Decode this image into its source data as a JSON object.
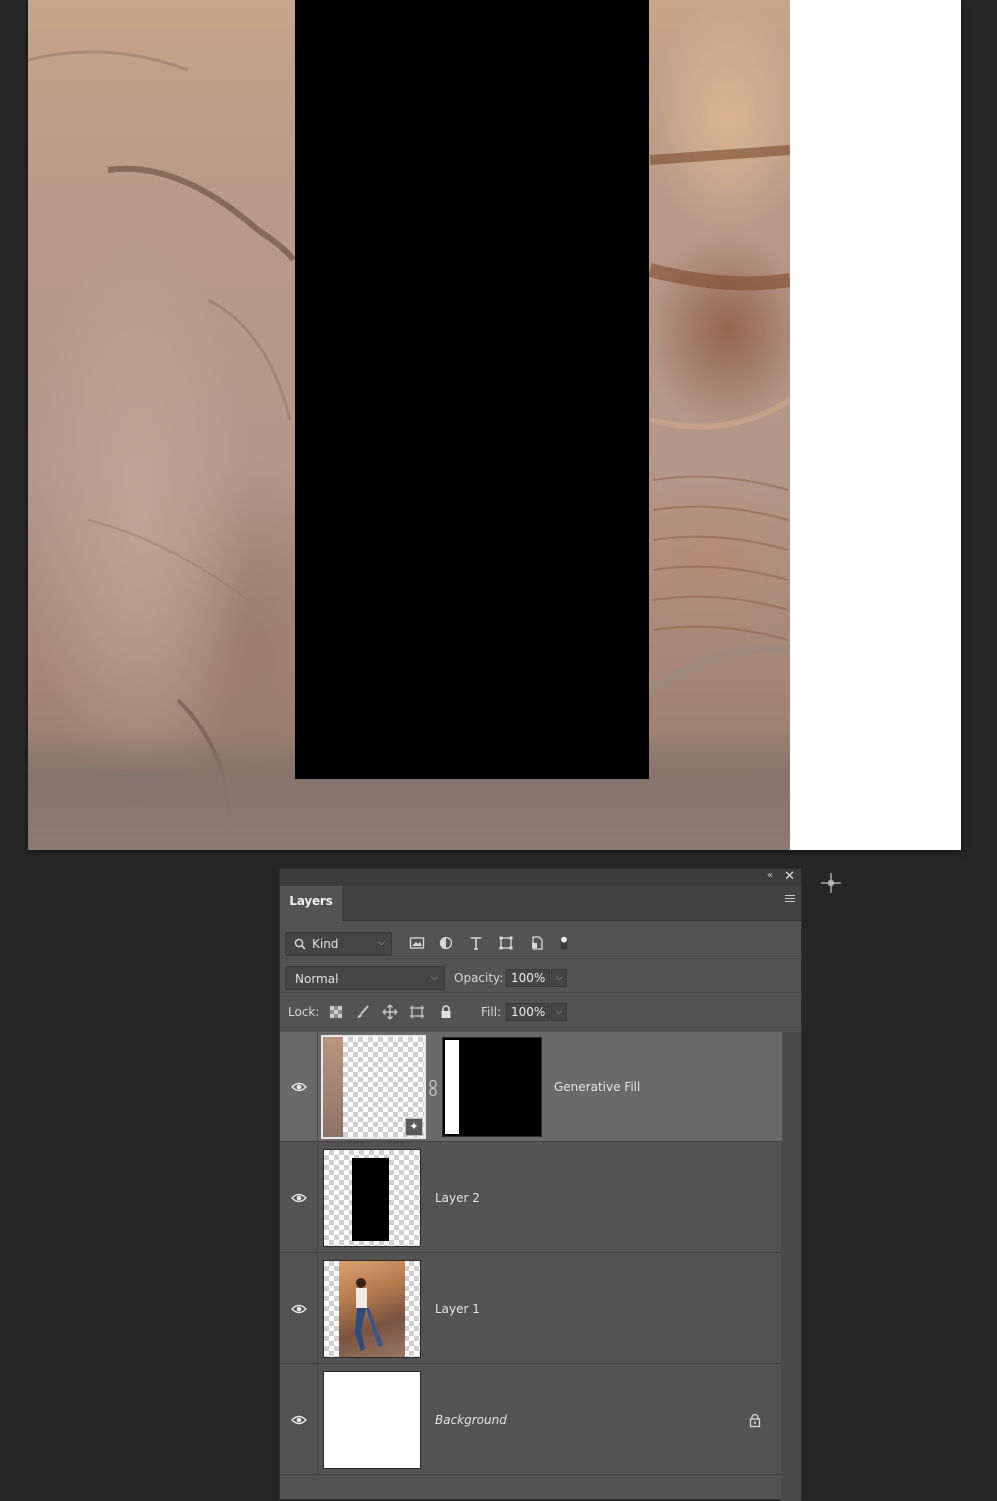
{
  "panel": {
    "tab_label": "Layers",
    "collapse_icon": "double-chevron-left-icon",
    "close_icon": "close-icon",
    "menu_icon": "panel-menu-icon"
  },
  "filter": {
    "kind_label": "Kind",
    "icons": [
      "image-filter-icon",
      "adjustment-filter-icon",
      "type-filter-icon",
      "shape-filter-icon",
      "smart-object-filter-icon",
      "filter-toggle-icon"
    ]
  },
  "blend": {
    "mode": "Normal",
    "opacity_label": "Opacity:",
    "opacity_value": "100%"
  },
  "lock": {
    "label": "Lock:",
    "icons": [
      "lock-transparent-pixels-icon",
      "lock-image-pixels-icon",
      "lock-position-icon",
      "lock-artboard-icon",
      "lock-all-icon"
    ],
    "fill_label": "Fill:",
    "fill_value": "100%"
  },
  "layers": [
    {
      "name": "Generative Fill",
      "visible": true,
      "selected": true,
      "has_mask": true
    },
    {
      "name": "Layer 2",
      "visible": true,
      "selected": false
    },
    {
      "name": "Layer 1",
      "visible": true,
      "selected": false
    },
    {
      "name": "Background",
      "visible": true,
      "selected": false,
      "locked": true
    }
  ],
  "colors": {
    "app_background": "#262626",
    "panel_background": "#535353",
    "selected_layer": "#696969"
  }
}
